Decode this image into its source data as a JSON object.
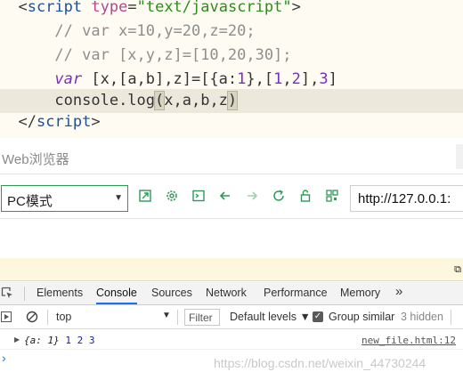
{
  "editor": {
    "lines": [
      {
        "indent": "",
        "tokens": [
          {
            "t": "<",
            "c": "c-punc"
          },
          {
            "t": "script",
            "c": "c-tag"
          },
          {
            "t": " ",
            "c": "c-plain"
          },
          {
            "t": "type",
            "c": "c-attr"
          },
          {
            "t": "=",
            "c": "c-punc"
          },
          {
            "t": "\"text/javascript\"",
            "c": "c-str"
          },
          {
            "t": ">",
            "c": "c-punc"
          }
        ]
      },
      {
        "indent": "    ",
        "tokens": [
          {
            "t": "// var x=10,y=20,z=20;",
            "c": "c-cmt"
          }
        ]
      },
      {
        "indent": "    ",
        "tokens": [
          {
            "t": "// var [x,y,z]=[10,20,30];",
            "c": "c-cmt"
          }
        ]
      },
      {
        "indent": "    ",
        "tokens": [
          {
            "t": "var",
            "c": "c-kw"
          },
          {
            "t": " [x,[a,b],z]=[{a:",
            "c": "c-plain"
          },
          {
            "t": "1",
            "c": "c-num"
          },
          {
            "t": "},[",
            "c": "c-plain"
          },
          {
            "t": "1",
            "c": "c-num"
          },
          {
            "t": ",",
            "c": "c-plain"
          },
          {
            "t": "2",
            "c": "c-num"
          },
          {
            "t": "],",
            "c": "c-plain"
          },
          {
            "t": "3",
            "c": "c-num"
          },
          {
            "t": "]",
            "c": "c-plain"
          }
        ]
      },
      {
        "indent": "    ",
        "current": true,
        "tokens": [
          {
            "t": "console.log",
            "c": "c-plain"
          },
          {
            "t": "(",
            "c": "c-plain c-paren-hl"
          },
          {
            "t": "x,a,b,z",
            "c": "c-plain"
          },
          {
            "t": ")",
            "c": "c-plain c-paren-hl"
          }
        ]
      },
      {
        "indent": "",
        "tokens": [
          {
            "t": "</",
            "c": "c-punc"
          },
          {
            "t": "script",
            "c": "c-tag"
          },
          {
            "t": ">",
            "c": "c-punc"
          }
        ]
      }
    ]
  },
  "browser": {
    "title": "Web浏览器",
    "mode": "PC模式",
    "url": "http://127.0.0.1:",
    "icons": [
      "screenshot-icon",
      "settings-icon",
      "console-icon",
      "back-icon",
      "forward-icon",
      "refresh-icon",
      "lock-icon",
      "qrcode-icon"
    ]
  },
  "devtools": {
    "tabs": [
      {
        "label": "Elements",
        "active": false
      },
      {
        "label": "Console",
        "active": true
      },
      {
        "label": "Sources",
        "active": false
      },
      {
        "label": "Network",
        "active": false
      },
      {
        "label": "Performance",
        "active": false
      },
      {
        "label": "Memory",
        "active": false
      }
    ],
    "more_label": "»",
    "console": {
      "context": "top",
      "filter_placeholder": "Filter",
      "levels_label": "Default levels ▼",
      "group_similar_label": "Group similar",
      "group_similar_checked": true,
      "hidden_count": "3 hidden",
      "log": {
        "object": "{a: 1}",
        "values": " 1 2 3",
        "source": "new_file.html:12"
      },
      "prompt": "›"
    }
  },
  "watermark": "https://blog.csdn.net/weixin_44730244",
  "colors": {
    "accent_green": "#2e9a57",
    "active_tab_blue": "#1a73e8",
    "editor_bg": "#fdfbf2",
    "dock_bg": "#fdf7dd"
  }
}
